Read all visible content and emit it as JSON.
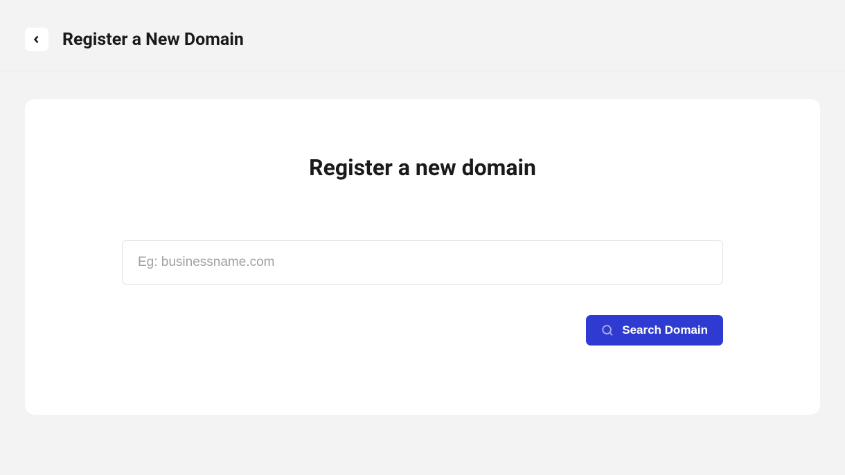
{
  "header": {
    "title": "Register a New Domain"
  },
  "main": {
    "heading": "Register a new domain",
    "search": {
      "value": "",
      "placeholder": "Eg: businessname.com"
    },
    "button_label": "Search Domain"
  }
}
